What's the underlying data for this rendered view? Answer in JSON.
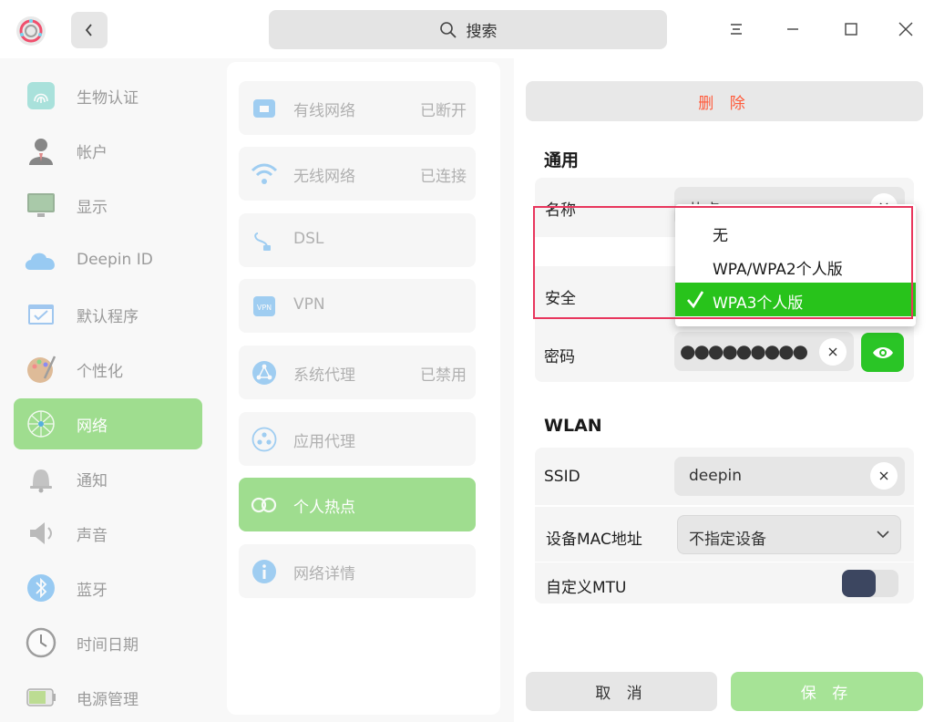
{
  "titlebar": {
    "search_label": "搜索"
  },
  "sidebar": {
    "items": [
      {
        "label": "生物认证",
        "icon": "fingerprint-icon"
      },
      {
        "label": "帐户",
        "icon": "account-icon"
      },
      {
        "label": "显示",
        "icon": "display-icon"
      },
      {
        "label": "Deepin ID",
        "icon": "cloud-icon"
      },
      {
        "label": "默认程序",
        "icon": "default-apps-icon"
      },
      {
        "label": "个性化",
        "icon": "palette-icon"
      },
      {
        "label": "网络",
        "icon": "network-icon",
        "active": true
      },
      {
        "label": "通知",
        "icon": "bell-icon"
      },
      {
        "label": "声音",
        "icon": "speaker-icon"
      },
      {
        "label": "蓝牙",
        "icon": "bluetooth-icon"
      },
      {
        "label": "时间日期",
        "icon": "clock-icon"
      },
      {
        "label": "电源管理",
        "icon": "battery-icon"
      }
    ]
  },
  "network_menu": {
    "items": [
      {
        "label": "有线网络",
        "status": "已断开",
        "icon": "wired-icon"
      },
      {
        "label": "无线网络",
        "status": "已连接",
        "icon": "wifi-icon"
      },
      {
        "label": "DSL",
        "status": "",
        "icon": "dsl-icon"
      },
      {
        "label": "VPN",
        "status": "",
        "icon": "vpn-icon"
      },
      {
        "label": "系统代理",
        "status": "已禁用",
        "icon": "system-proxy-icon"
      },
      {
        "label": "应用代理",
        "status": "",
        "icon": "app-proxy-icon"
      },
      {
        "label": "个人热点",
        "status": "",
        "icon": "hotspot-icon",
        "active": true
      },
      {
        "label": "网络详情",
        "status": "",
        "icon": "info-icon"
      }
    ]
  },
  "detail": {
    "delete_label": "删 除",
    "general_title": "通用",
    "name_label": "名称",
    "name_value": "热点",
    "security_label": "安全",
    "password_label": "密码",
    "password_value": "●●●●●●●●●",
    "wlan_title": "WLAN",
    "ssid_label": "SSID",
    "ssid_value": "deepin",
    "mac_label": "设备MAC地址",
    "mac_value": "不指定设备",
    "mtu_label": "自定义MTU",
    "mtu_enabled": false,
    "cancel_label": "取 消",
    "save_label": "保 存"
  },
  "security_menu": {
    "options": [
      "无",
      "WPA/WPA2个人版",
      "WPA3个人版"
    ],
    "selected": "WPA3个人版"
  },
  "colors": {
    "accent_green": "#28c31b",
    "active_bg": "#9fdd8f",
    "delete_red": "#ff5a3a",
    "highlight_border": "#e8365d"
  }
}
